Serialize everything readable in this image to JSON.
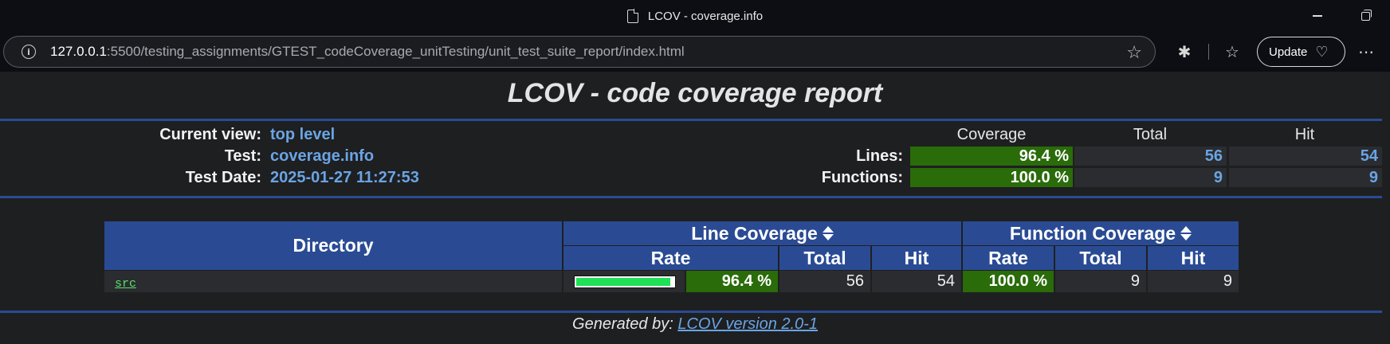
{
  "window": {
    "title": "LCOV - coverage.info"
  },
  "browser": {
    "url_host": "127.0.0.1",
    "url_rest": ":5500/testing_assignments/GTEST_codeCoverage_unitTesting/unit_test_suite_report/index.html",
    "update_label": "Update"
  },
  "report": {
    "title": "LCOV - code coverage report",
    "header": {
      "current_view_label": "Current view:",
      "current_view_value": "top level",
      "test_label": "Test:",
      "test_value": "coverage.info",
      "date_label": "Test Date:",
      "date_value": "2025-01-27 11:27:53"
    },
    "summary": {
      "col_coverage": "Coverage",
      "col_total": "Total",
      "col_hit": "Hit",
      "lines_label": "Lines:",
      "lines_rate": "96.4 %",
      "lines_total": "56",
      "lines_hit": "54",
      "functions_label": "Functions:",
      "functions_rate": "100.0 %",
      "functions_total": "9",
      "functions_hit": "9"
    },
    "table": {
      "directory_header": "Directory",
      "line_coverage_header": "Line Coverage",
      "function_coverage_header": "Function Coverage",
      "rate": "Rate",
      "total": "Total",
      "hit": "Hit",
      "rows": [
        {
          "name": "src",
          "line_rate": "96.4 %",
          "line_fraction": 0.964,
          "line_total": "56",
          "line_hit": "54",
          "func_rate": "100.0 %",
          "func_total": "9",
          "func_hit": "9"
        }
      ]
    },
    "footer": {
      "generated_by": "Generated by:",
      "version_link": "LCOV version 2.0-1"
    }
  },
  "colors": {
    "header_blue": "#2a4b94",
    "coverage_green": "#2a6b0a",
    "bar_green": "#1fe056",
    "link_blue": "#6aa4e4"
  }
}
